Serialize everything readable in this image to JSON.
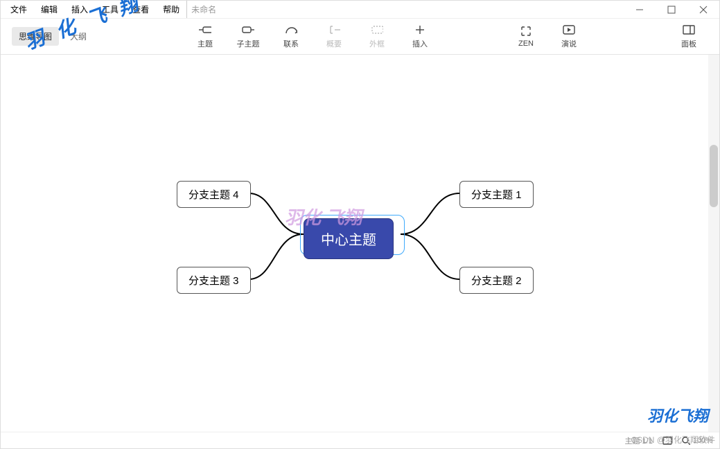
{
  "menu": {
    "items": [
      "文件",
      "编辑",
      "插入",
      "工具",
      "查看",
      "帮助"
    ],
    "doc_title": "未命名"
  },
  "view_tabs": {
    "active": "思维导图",
    "inactive": "大纲"
  },
  "toolbar": {
    "topic": "主题",
    "subtopic": "子主题",
    "relationship": "联系",
    "summary": "概要",
    "boundary": "外框",
    "insert": "插入",
    "zen": "ZEN",
    "present": "演说",
    "panel": "面板"
  },
  "mindmap": {
    "center": "中心主题",
    "branches": [
      "分支主题 1",
      "分支主题 2",
      "分支主题 3",
      "分支主题 4"
    ]
  },
  "status": {
    "count": "主题 1/1",
    "zoom": "100%"
  },
  "watermarks": {
    "wm1": "羽 化 飞 翔",
    "wm2": "羽化 飞翔",
    "wm3": "羽化飞翔",
    "wm4": "CSDN @羽化飞翔软件"
  }
}
